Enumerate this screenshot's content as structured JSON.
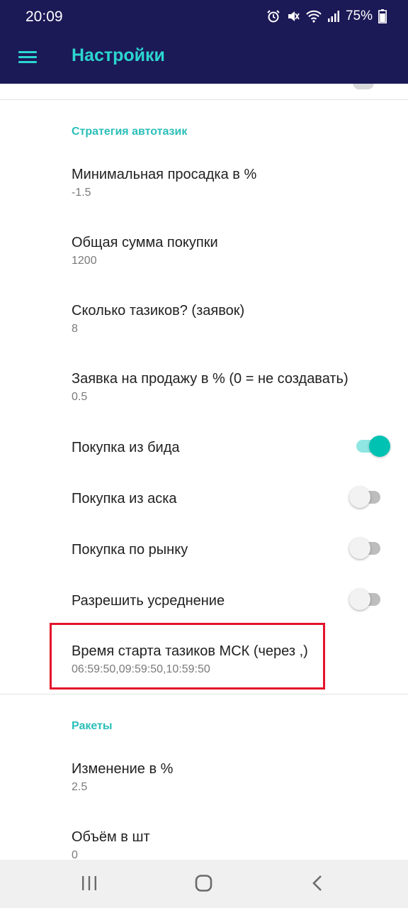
{
  "status_bar": {
    "time": "20:09",
    "battery": "75%",
    "icons": [
      "alarm-icon",
      "mute-icon",
      "wifi-icon",
      "signal-icon",
      "battery-icon"
    ]
  },
  "app_bar": {
    "title": "Настройки",
    "menu_icon": "menu-icon"
  },
  "sections": {
    "strategy": {
      "title": "Стратегия автотазик",
      "items": [
        {
          "title": "Минимальная просадка в %",
          "summary": "-1.5"
        },
        {
          "title": "Общая сумма покупки",
          "summary": "1200"
        },
        {
          "title": "Сколько тазиков? (заявок)",
          "summary": "8"
        },
        {
          "title": "Заявка на продажу в % (0 = не создавать)",
          "summary": "0.5"
        },
        {
          "title": "Покупка из бида",
          "switch_on": true
        },
        {
          "title": "Покупка из аска",
          "switch_on": false
        },
        {
          "title": "Покупка по рынку",
          "switch_on": false
        },
        {
          "title": "Разрешить усреднение",
          "switch_on": false
        },
        {
          "title": "Время старта тазиков МСК (через ,)",
          "summary": "06:59:50,09:59:50,10:59:50"
        }
      ]
    },
    "rockets": {
      "title": "Ракеты",
      "items": [
        {
          "title": "Изменение в %",
          "summary": "2.5"
        },
        {
          "title": "Объём в шт",
          "summary": "0"
        }
      ]
    }
  },
  "colors": {
    "app_bar": "#1c1957",
    "accent": "#2bd6cf",
    "highlight": "#e3122b"
  },
  "nav_bar": {
    "icons": [
      "recent-apps-icon",
      "home-icon",
      "back-icon"
    ]
  }
}
